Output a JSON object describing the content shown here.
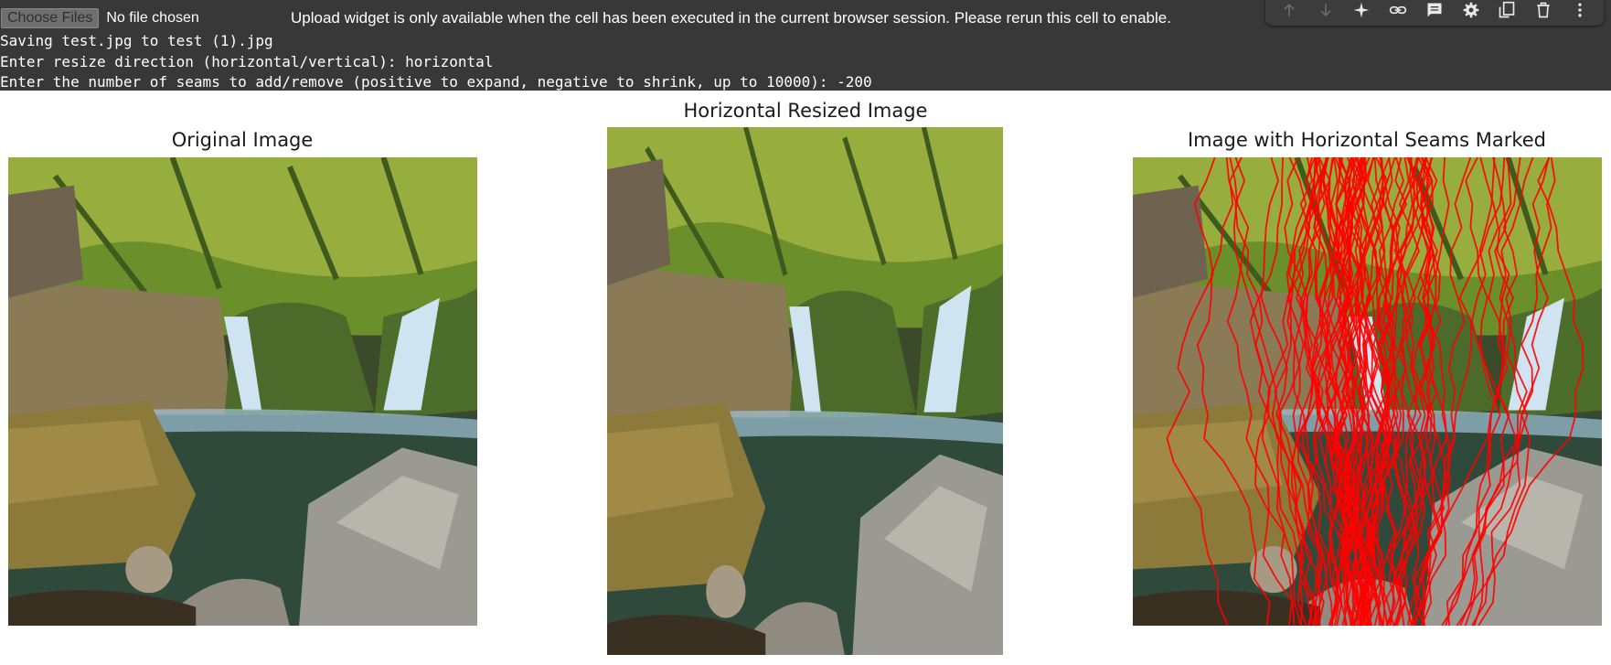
{
  "upload": {
    "button_label": "Choose Files",
    "file_status": "No file chosen",
    "message": "Upload widget is only available when the cell has been executed in the current browser session. Please rerun this cell to enable."
  },
  "toolbar": {
    "icons": [
      "arrow-up-icon",
      "arrow-down-icon",
      "sparkle-icon",
      "link-icon",
      "comment-icon",
      "gear-icon",
      "mirror-cell-icon",
      "delete-icon",
      "more-vert-icon"
    ]
  },
  "console": {
    "lines": [
      "Saving test.jpg to test (1).jpg",
      "Enter resize direction (horizontal/vertical): horizontal",
      "Enter the number of seams to add/remove (positive to expand, negative to shrink, up to 10000): -200"
    ]
  },
  "figures": {
    "original": {
      "title": "Original Image"
    },
    "resized": {
      "title": "Horizontal Resized Image"
    },
    "seams": {
      "title": "Image with Horizontal Seams Marked",
      "seam_color": "#ff0000"
    }
  },
  "colors": {
    "output_bg": "#383838",
    "foliage": "#6b8f2a",
    "rock": "#8a7a55",
    "water": "#2f4a3a",
    "waterfall": "#cfe3f0"
  }
}
